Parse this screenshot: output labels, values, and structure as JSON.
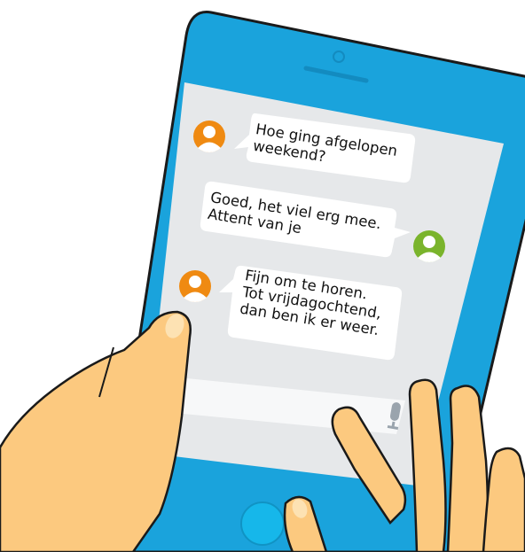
{
  "messages": [
    {
      "sender": "contact",
      "lines": [
        "Hoe ging afgelopen",
        "weekend?"
      ]
    },
    {
      "sender": "user",
      "lines": [
        "Goed, het viel erg mee.",
        "Attent van je"
      ]
    },
    {
      "sender": "contact",
      "lines": [
        "Fijn om te horen.",
        "Tot vrijdagochtend,",
        "dan ben ik er weer."
      ]
    }
  ],
  "colors": {
    "phone_body": "#1aa3dc",
    "phone_outline": "#1a1a1a",
    "screen": "#e6e8ea",
    "bubble": "#ffffff",
    "contact_avatar": "#ef8a12",
    "user_avatar": "#7ab42c",
    "skin": "#fcc97f",
    "home_button": "#16b7ea",
    "mic": "#9aa4ad"
  },
  "icons": [
    "contact-avatar-icon",
    "user-avatar-icon",
    "microphone-icon",
    "home-button",
    "front-camera-icon",
    "earpiece-speaker"
  ]
}
